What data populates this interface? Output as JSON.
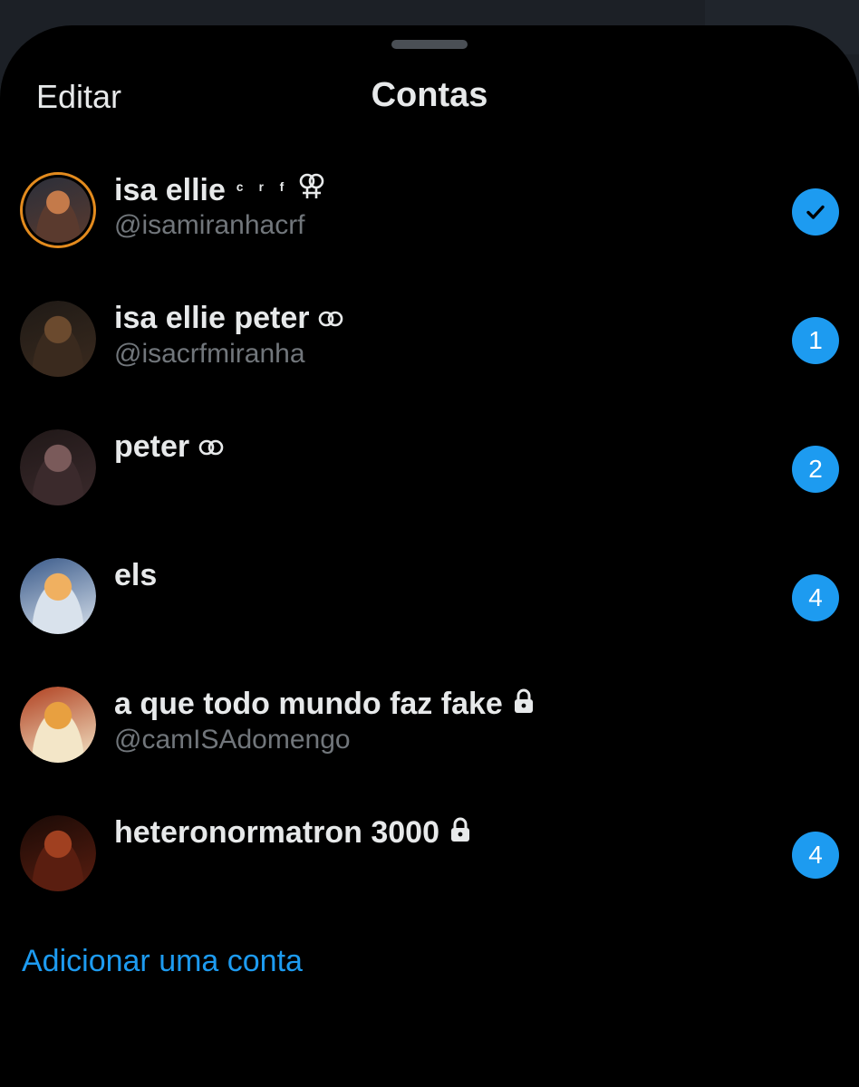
{
  "header": {
    "edit_label": "Editar",
    "title": "Contas"
  },
  "accounts": [
    {
      "name": "isa ellie",
      "name_suffix": "ᶜ ʳ ᶠ",
      "name_icon": "female-couple-symbol-icon",
      "handle": "@isamiranhacrf",
      "status": "selected",
      "badge": "",
      "avatar_colors": [
        "#5a3a2e",
        "#c47a4a",
        "#2b2f3a"
      ]
    },
    {
      "name": "isa ellie peter",
      "name_icon": "rings-icon",
      "handle": "@isacrfmiranha",
      "badge": "1",
      "avatar_colors": [
        "#3a2a1e",
        "#6b4a2e",
        "#1f1a16"
      ]
    },
    {
      "name": "peter",
      "name_icon": "rings-icon",
      "handle": "",
      "badge": "2",
      "avatar_colors": [
        "#3b2a2c",
        "#7a5a5a",
        "#201818"
      ]
    },
    {
      "name": "els",
      "handle": "",
      "badge": "4",
      "avatar_colors": [
        "#d9e2ec",
        "#f0b060",
        "#3a5a8a"
      ]
    },
    {
      "name": "a que todo mundo faz fake",
      "name_icon": "lock-icon",
      "handle": "@camISAdomengo",
      "badge": "",
      "avatar_colors": [
        "#f3e6c8",
        "#e8a040",
        "#b04020"
      ]
    },
    {
      "name": "heteronormatron 3000",
      "name_icon": "lock-icon",
      "handle": "",
      "badge": "4",
      "avatar_colors": [
        "#5a1e10",
        "#a04020",
        "#1a0a06"
      ]
    }
  ],
  "footer": {
    "add_account_label": "Adicionar uma conta"
  },
  "colors": {
    "accent": "#1d9bf0",
    "text": "#e7e9ea",
    "muted": "#71767b",
    "background": "#000000"
  }
}
